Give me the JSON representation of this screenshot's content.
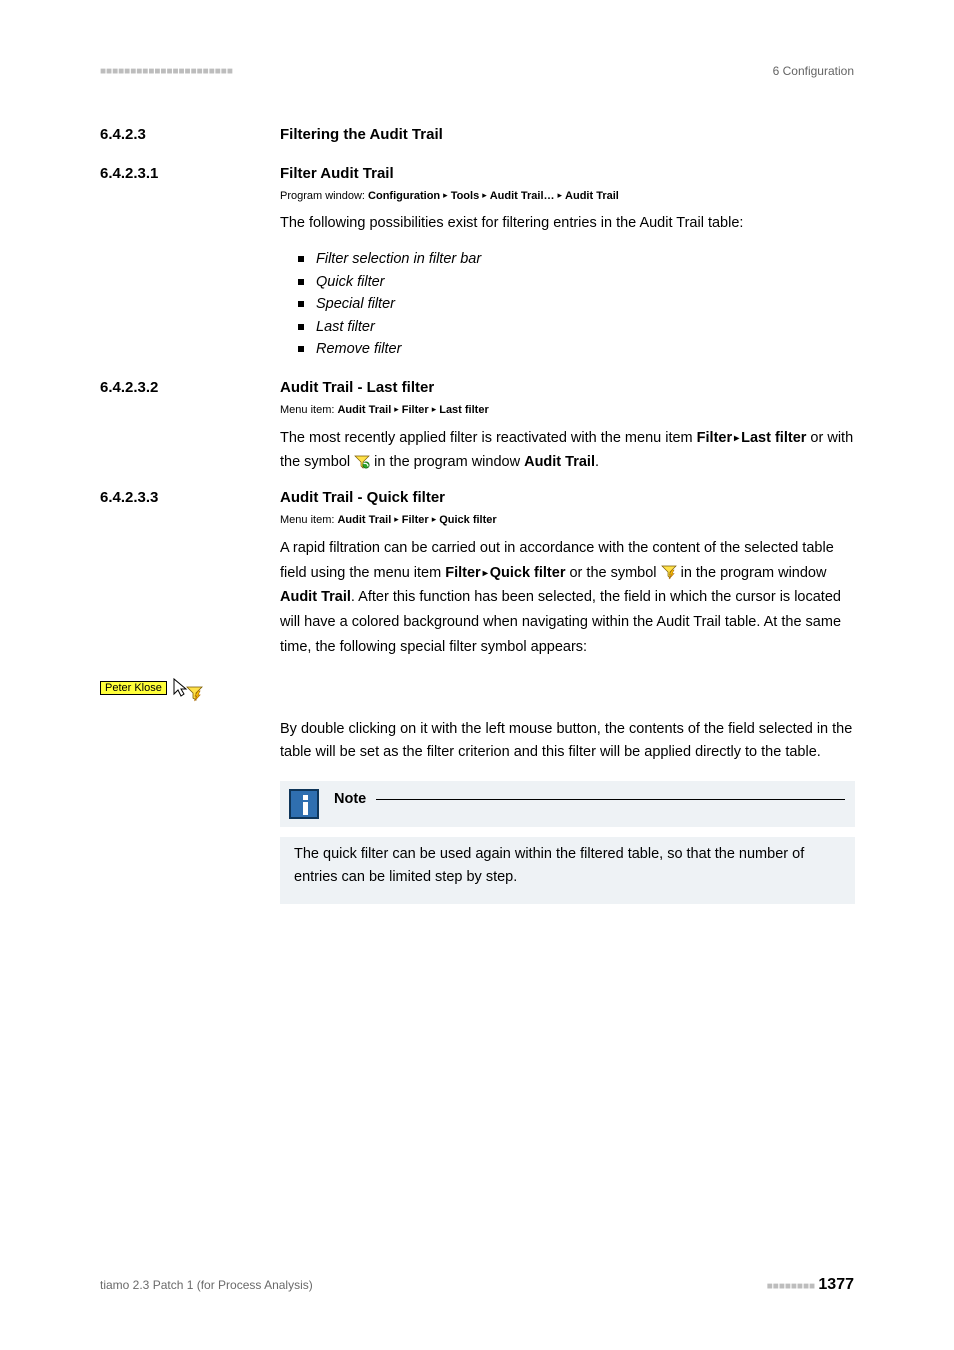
{
  "header": {
    "dashes_left": "■■■■■■■■■■■■■■■■■■■■■■",
    "chapter": "6 Configuration"
  },
  "sections": {
    "s1": {
      "num": "6.4.2.3",
      "title": "Filtering the Audit Trail"
    },
    "s11": {
      "num": "6.4.2.3.1",
      "title": "Filter Audit Trail"
    },
    "s12": {
      "num": "6.4.2.3.2",
      "title": "Audit Trail - Last filter"
    },
    "s13": {
      "num": "6.4.2.3.3",
      "title": "Audit Trail - Quick filter"
    }
  },
  "crumbs": {
    "c1": {
      "label": "Program window: ",
      "parts": [
        "Configuration",
        "Tools",
        "Audit Trail…",
        "Audit Trail"
      ]
    },
    "c2": {
      "label": "Menu item: ",
      "parts": [
        "Audit Trail",
        "Filter",
        "Last filter"
      ]
    },
    "c3": {
      "label": "Menu item: ",
      "parts": [
        "Audit Trail",
        "Filter",
        "Quick filter"
      ]
    }
  },
  "body": {
    "intro1": "The following possibilities exist for filtering entries in the Audit Trail table:",
    "list": [
      "Filter selection in filter bar",
      "Quick filter",
      "Special filter",
      "Last filter",
      "Remove filter"
    ],
    "last_1": "The most recently applied filter is reactivated with the menu item ",
    "last_b1": "Filter",
    "last_b2": "Last filter",
    "last_2": " or with the symbol ",
    "last_3": " in the program window ",
    "last_b3": "Audit Trail",
    "last_4": ".",
    "quick_1a": "A rapid filtration can be carried out in accordance with the content of the selected table field using the menu item ",
    "quick_b1": "Filter",
    "quick_b2": "Quick filter",
    "quick_1b": " or the symbol ",
    "quick_2a": " in the program window ",
    "quick_b3": "Audit Trail",
    "quick_2b": ". After this function has been selected, the field in which the cursor is located will have a colored background when navigating within the Audit Trail table. At the same time, the following special filter symbol appears:",
    "highlight_name": "Peter Klose",
    "quick_3": "By double clicking on it with the left mouse button, the contents of the field selected in the table will be set as the filter criterion and this filter will be applied directly to the table.",
    "note_title": "Note",
    "note_body": "The quick filter can be used again within the filtered table, so that the number of entries can be limited step by step."
  },
  "footer": {
    "product": "tiamo 2.3 Patch 1 (for Process Analysis)",
    "dashes": "■■■■■■■■",
    "page": "1377"
  }
}
